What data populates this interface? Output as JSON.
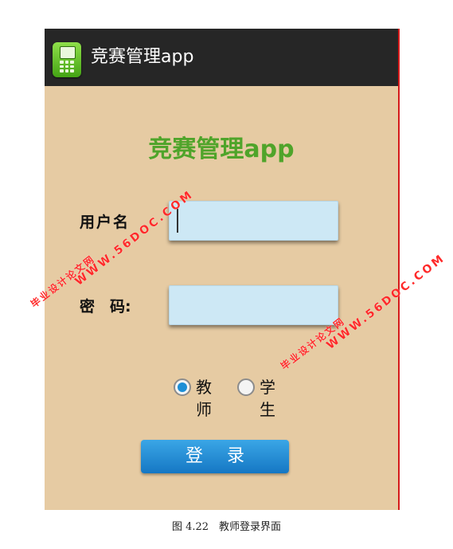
{
  "app_bar": {
    "icon": "phone-app-icon",
    "title": "竞赛管理app"
  },
  "form": {
    "heading": "竞赛管理app",
    "username_label": "用户名",
    "username_value": "",
    "password_label": "密　码:",
    "password_value": "",
    "role_options": [
      {
        "label": "教师",
        "selected": true
      },
      {
        "label": "学生",
        "selected": false
      }
    ],
    "login_button": "登录"
  },
  "watermarks": [
    {
      "url": "WWW.56DOC.COM",
      "text": "毕业设计论文网"
    },
    {
      "url": "WWW.56DOC.COM",
      "text": "毕业设计论文网"
    }
  ],
  "caption": "图 4.22　教师登录界面",
  "colors": {
    "app_background": "#e6cba3",
    "action_bar": "#262626",
    "heading": "#4fa42a",
    "input_fill": "#cde8f5",
    "button": "#1f86d0",
    "radio_selected": "#1d8fd6",
    "watermark": "#ff2a2a",
    "frame_edge": "#d51a1a"
  }
}
